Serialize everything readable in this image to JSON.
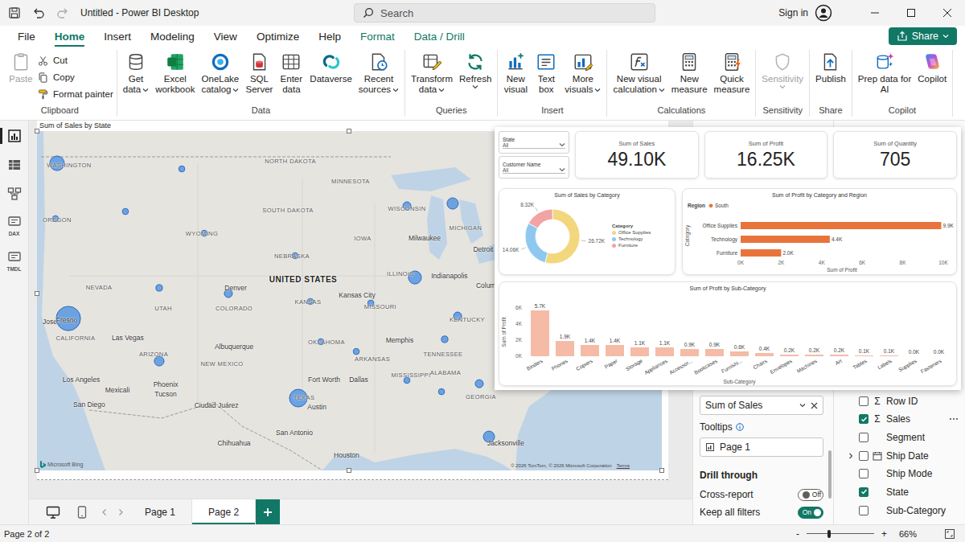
{
  "window": {
    "title": "Untitled - Power BI Desktop",
    "search_placeholder": "Search",
    "sign_in": "Sign in"
  },
  "menu_tabs": [
    {
      "label": "File",
      "selected": false,
      "kind": "plain"
    },
    {
      "label": "Home",
      "selected": true,
      "kind": "plain"
    },
    {
      "label": "Insert",
      "selected": false,
      "kind": "plain"
    },
    {
      "label": "Modeling",
      "selected": false,
      "kind": "plain"
    },
    {
      "label": "View",
      "selected": false,
      "kind": "plain"
    },
    {
      "label": "Optimize",
      "selected": false,
      "kind": "plain"
    },
    {
      "label": "Help",
      "selected": false,
      "kind": "plain"
    },
    {
      "label": "Format",
      "selected": false,
      "kind": "context"
    },
    {
      "label": "Data / Drill",
      "selected": false,
      "kind": "context"
    }
  ],
  "share_button": {
    "label": "Share",
    "dropdown": true
  },
  "ribbon_groups": [
    {
      "title": "Clipboard",
      "items": [
        {
          "lines": [
            "Paste"
          ],
          "kind": "large",
          "disabled": true,
          "dropdown": false
        },
        {
          "lines": [
            "Cut"
          ],
          "kind": "small",
          "disabled": false,
          "dropdown": false
        },
        {
          "lines": [
            "Copy"
          ],
          "kind": "small",
          "disabled": false,
          "dropdown": false
        },
        {
          "lines": [
            "Format painter"
          ],
          "kind": "small",
          "disabled": false,
          "dropdown": false
        }
      ]
    },
    {
      "title": "Data",
      "items": [
        {
          "lines": [
            "Get",
            "data"
          ],
          "kind": "large",
          "disabled": false,
          "dropdown": true
        },
        {
          "lines": [
            "Excel",
            "workbook"
          ],
          "kind": "large",
          "disabled": false,
          "dropdown": false
        },
        {
          "lines": [
            "OneLake",
            "catalog"
          ],
          "kind": "large",
          "disabled": false,
          "dropdown": true
        },
        {
          "lines": [
            "SQL",
            "Server"
          ],
          "kind": "large",
          "disabled": false,
          "dropdown": false
        },
        {
          "lines": [
            "Enter",
            "data"
          ],
          "kind": "large",
          "disabled": false,
          "dropdown": false
        },
        {
          "lines": [
            "Dataverse"
          ],
          "kind": "large",
          "disabled": false,
          "dropdown": false
        },
        {
          "lines": [
            "Recent",
            "sources"
          ],
          "kind": "large",
          "disabled": false,
          "dropdown": true
        }
      ]
    },
    {
      "title": "Queries",
      "items": [
        {
          "lines": [
            "Transform",
            "data"
          ],
          "kind": "large",
          "disabled": false,
          "dropdown": true
        },
        {
          "lines": [
            "Refresh"
          ],
          "kind": "large",
          "disabled": false,
          "dropdown": true
        }
      ]
    },
    {
      "title": "Insert",
      "items": [
        {
          "lines": [
            "New",
            "visual"
          ],
          "kind": "large",
          "disabled": false,
          "dropdown": false
        },
        {
          "lines": [
            "Text",
            "box"
          ],
          "kind": "large",
          "disabled": false,
          "dropdown": false
        },
        {
          "lines": [
            "More",
            "visuals"
          ],
          "kind": "large",
          "disabled": false,
          "dropdown": true
        }
      ]
    },
    {
      "title": "Calculations",
      "items": [
        {
          "lines": [
            "New visual",
            "calculation"
          ],
          "kind": "large",
          "disabled": false,
          "dropdown": true
        },
        {
          "lines": [
            "New",
            "measure"
          ],
          "kind": "large",
          "disabled": false,
          "dropdown": false
        },
        {
          "lines": [
            "Quick",
            "measure"
          ],
          "kind": "large",
          "disabled": false,
          "dropdown": false
        }
      ]
    },
    {
      "title": "Sensitivity",
      "items": [
        {
          "lines": [
            "Sensitivity"
          ],
          "kind": "large",
          "disabled": true,
          "dropdown": true
        }
      ]
    },
    {
      "title": "Share",
      "items": [
        {
          "lines": [
            "Publish"
          ],
          "kind": "large",
          "disabled": false,
          "dropdown": false
        }
      ]
    },
    {
      "title": "Copilot",
      "items": [
        {
          "lines": [
            "Prep data for",
            "AI"
          ],
          "kind": "large",
          "disabled": false,
          "dropdown": false
        },
        {
          "lines": [
            "Copilot"
          ],
          "kind": "large",
          "disabled": false,
          "dropdown": false
        }
      ]
    }
  ],
  "left_rail": [
    {
      "selected": true
    },
    {
      "selected": false
    },
    {
      "selected": false
    },
    {
      "selected": false,
      "caption": "DAX"
    },
    {
      "selected": false,
      "caption": "TMDL"
    }
  ],
  "map_visual": {
    "title": "Sum of Sales by State",
    "selected": true,
    "labels": [
      {
        "text": "WASHINGTON",
        "kind": "state",
        "lon": -119.72,
        "lat": 47.6
      },
      {
        "text": "OREGON",
        "kind": "state",
        "lon": -120.78,
        "lat": 44.19
      },
      {
        "text": "NORTH DAKOTA",
        "kind": "state",
        "lon": -100.34,
        "lat": 47.85
      },
      {
        "text": "MINNESOTA",
        "kind": "state",
        "lon": -95.06,
        "lat": 46.6
      },
      {
        "text": "SOUTH DAKOTA",
        "kind": "state",
        "lon": -100.55,
        "lat": 44.79
      },
      {
        "text": "WYOMING",
        "kind": "state",
        "lon": -108.09,
        "lat": 43.33
      },
      {
        "text": "WISCONSIN",
        "kind": "state",
        "lon": -90.12,
        "lat": 44.89
      },
      {
        "text": "MICHIGAN",
        "kind": "state",
        "lon": -84.98,
        "lat": 43.69
      },
      {
        "text": "Milwaukee",
        "kind": "city",
        "lon": -88.57,
        "lat": 43.03
      },
      {
        "text": "IOWA",
        "kind": "state",
        "lon": -94.0,
        "lat": 43.03
      },
      {
        "text": "NEBRASKA",
        "kind": "state",
        "lon": -100.2,
        "lat": 41.93
      },
      {
        "text": "Detroit",
        "kind": "city",
        "lon": -83.43,
        "lat": 42.33
      },
      {
        "text": "NEVADA",
        "kind": "state",
        "lon": -117.11,
        "lat": 39.97
      },
      {
        "text": "UNITED STATES",
        "kind": "country",
        "lon": -99.21,
        "lat": 40.47
      },
      {
        "text": "Denver",
        "kind": "city",
        "lon": -105.13,
        "lat": 39.92
      },
      {
        "text": "ILLINOIS",
        "kind": "state",
        "lon": -90.69,
        "lat": 40.82
      },
      {
        "text": "Indianapolis",
        "kind": "city",
        "lon": -86.39,
        "lat": 40.67
      },
      {
        "text": "Columbus",
        "kind": "city",
        "lon": -82.72,
        "lat": 40.07
      },
      {
        "text": "UTAH",
        "kind": "state",
        "lon": -111.47,
        "lat": 38.67
      },
      {
        "text": "COLORADO",
        "kind": "state",
        "lon": -105.27,
        "lat": 38.67
      },
      {
        "text": "KANSAS",
        "kind": "state",
        "lon": -98.79,
        "lat": 39.07
      },
      {
        "text": "Kansas City",
        "kind": "city",
        "lon": -94.49,
        "lat": 39.47
      },
      {
        "text": "MISSOURI",
        "kind": "state",
        "lon": -92.45,
        "lat": 38.77
      },
      {
        "text": "KENTUCKY",
        "kind": "state",
        "lon": -84.84,
        "lat": 37.96
      },
      {
        "text": "Jose",
        "kind": "city",
        "lon": -121.41,
        "lat": 37.8
      },
      {
        "text": "Fresno",
        "kind": "city",
        "lon": -119.93,
        "lat": 37.91
      },
      {
        "text": "CALIFORNIA",
        "kind": "state",
        "lon": -119.16,
        "lat": 36.81
      },
      {
        "text": "Las Vegas",
        "kind": "city",
        "lon": -114.58,
        "lat": 36.81
      },
      {
        "text": "TENNESSEE",
        "kind": "state",
        "lon": -86.95,
        "lat": 35.8
      },
      {
        "text": "Los Angeles",
        "kind": "city",
        "lon": -118.66,
        "lat": 34.2
      },
      {
        "text": "ARIZONA",
        "kind": "state",
        "lon": -112.32,
        "lat": 35.8
      },
      {
        "text": "Albuquerque",
        "kind": "city",
        "lon": -105.27,
        "lat": 36.26
      },
      {
        "text": "OKLAHOMA",
        "kind": "state",
        "lon": -97.17,
        "lat": 36.56
      },
      {
        "text": "NEW MEXICO",
        "kind": "state",
        "lon": -106.33,
        "lat": 35.2
      },
      {
        "text": "Memphis",
        "kind": "city",
        "lon": -90.76,
        "lat": 36.66
      },
      {
        "text": "ARKANSAS",
        "kind": "state",
        "lon": -93.15,
        "lat": 35.5
      },
      {
        "text": "San Diego",
        "kind": "city",
        "lon": -117.96,
        "lat": 32.64
      },
      {
        "text": "Phoenix",
        "kind": "city",
        "lon": -111.26,
        "lat": 33.9
      },
      {
        "text": "Mexicali",
        "kind": "city",
        "lon": -115.49,
        "lat": 33.55
      },
      {
        "text": "Tucson",
        "kind": "city",
        "lon": -111.26,
        "lat": 33.29
      },
      {
        "text": "Fort Worth",
        "kind": "city",
        "lon": -97.38,
        "lat": 34.2
      },
      {
        "text": "Dallas",
        "kind": "city",
        "lon": -94.35,
        "lat": 34.2
      },
      {
        "text": "MISSISSIPPI",
        "kind": "state",
        "lon": -89.77,
        "lat": 34.5
      },
      {
        "text": "ALABAMA",
        "kind": "state",
        "lon": -86.74,
        "lat": 34.65
      },
      {
        "text": "GEORGIA",
        "kind": "state",
        "lon": -83.64,
        "lat": 33.14
      },
      {
        "text": "Ciudad Juárez",
        "kind": "city",
        "lon": -106.82,
        "lat": 32.59
      },
      {
        "text": "Chihuahua",
        "kind": "city",
        "lon": -105.27,
        "lat": 30.23
      },
      {
        "text": "TEXAS",
        "kind": "state",
        "lon": -99.14,
        "lat": 33.09
      },
      {
        "text": "Austin",
        "kind": "city",
        "lon": -98.01,
        "lat": 32.49
      },
      {
        "text": "San Antonio",
        "kind": "city",
        "lon": -99.99,
        "lat": 30.88
      },
      {
        "text": "Houston",
        "kind": "city",
        "lon": -95.41,
        "lat": 29.48
      },
      {
        "text": "Jacksonville",
        "kind": "city",
        "lon": -81.45,
        "lat": 30.23
      }
    ],
    "bubbles": [
      {
        "lon": -120.78,
        "lat": 47.7,
        "sales": 3.0
      },
      {
        "lon": -109.85,
        "lat": 47.35,
        "sales": 0.05
      },
      {
        "lon": -120.92,
        "lat": 44.24,
        "sales": 0.05
      },
      {
        "lon": -114.79,
        "lat": 44.69,
        "sales": 0.05
      },
      {
        "lon": -107.88,
        "lat": 43.33,
        "sales": 0.05
      },
      {
        "lon": -111.83,
        "lat": 39.92,
        "sales": 0.1
      },
      {
        "lon": -119.79,
        "lat": 38.01,
        "sales": 12.0
      },
      {
        "lon": -105.77,
        "lat": 39.57,
        "sales": 0.33
      },
      {
        "lon": -111.83,
        "lat": 35.35,
        "sales": 0.75
      },
      {
        "lon": -99.92,
        "lat": 41.93,
        "sales": 0.05
      },
      {
        "lon": -98.58,
        "lat": 39.07,
        "sales": 0.05
      },
      {
        "lon": -97.66,
        "lat": 36.56,
        "sales": 0.05
      },
      {
        "lon": -93.29,
        "lat": 38.97,
        "sales": 0.05
      },
      {
        "lon": -94.56,
        "lat": 35.95,
        "sales": 0.05
      },
      {
        "lon": -90.12,
        "lat": 45.04,
        "sales": 0.33
      },
      {
        "lon": -86.11,
        "lat": 45.19,
        "sales": 1.3
      },
      {
        "lon": -89.42,
        "lat": 40.57,
        "sales": 2.1
      },
      {
        "lon": -85.68,
        "lat": 38.16,
        "sales": 0.33
      },
      {
        "lon": -86.81,
        "lat": 36.71,
        "sales": 0.1
      },
      {
        "lon": -90.12,
        "lat": 34.15,
        "sales": 0.05
      },
      {
        "lon": -87.09,
        "lat": 33.44,
        "sales": 0.05
      },
      {
        "lon": -83.78,
        "lat": 33.94,
        "sales": 0.33
      },
      {
        "lon": -99.64,
        "lat": 33.04,
        "sales": 5.2
      },
      {
        "lon": -82.93,
        "lat": 30.63,
        "sales": 1.3
      }
    ],
    "attribution": {
      "brand": "Microsoft Bing",
      "copyright": "© 2026 TomTom, © 2026 Microsoft Corporation",
      "terms": "Terms"
    }
  },
  "tooltip_page": {
    "slicers": [
      {
        "label": "State",
        "value": "All"
      },
      {
        "label": "Customer Name",
        "value": "All"
      }
    ],
    "cards": [
      {
        "label": "Sum of Sales",
        "value": "49.10K"
      },
      {
        "label": "Sum of Profit",
        "value": "16.25K"
      },
      {
        "label": "Sum of Quantity",
        "value": "705"
      }
    ],
    "donut": {
      "title": "Sum of Sales by Category",
      "legend_title": "Category",
      "slices": [
        {
          "label": "Office Supplies",
          "value": 26.72,
          "value_label": "26.72K",
          "color": "#f2d77e"
        },
        {
          "label": "Technology",
          "value": 14.06,
          "value_label": "14.06K",
          "color": "#8fc8ef"
        },
        {
          "label": "Furniture",
          "value": 8.32,
          "value_label": "8.32K",
          "color": "#f2a3a3"
        }
      ]
    },
    "bar_chart": {
      "title": "Sum of Profit by Category and Region",
      "legend_title": "Region",
      "series": {
        "name": "South",
        "color": "#e8743b"
      },
      "categories": [
        {
          "label": "Office Supplies",
          "value": 9.9,
          "value_label": "9.9K"
        },
        {
          "label": "Technology",
          "value": 4.4,
          "value_label": "4.4K"
        },
        {
          "label": "Furniture",
          "value": 2.0,
          "value_label": "2.0K"
        }
      ],
      "x_ticks": [
        "0K",
        "2K",
        "4K",
        "6K",
        "8K",
        "10K"
      ],
      "x_title": "Sum of Profit",
      "y_title": "Category"
    },
    "column_chart": {
      "title": "Sum of Profit by Sub-Category",
      "color": "#f5bba6",
      "y_ticks": [
        "0K",
        "2K",
        "4K",
        "6K"
      ],
      "y_title": "Sum of Profit",
      "x_title": "Sub-Category",
      "bars": [
        {
          "label": "Binders",
          "value": 5.7,
          "value_label": "5.7K"
        },
        {
          "label": "Phones",
          "value": 1.9,
          "value_label": "1.9K"
        },
        {
          "label": "Copiers",
          "value": 1.4,
          "value_label": "1.4K"
        },
        {
          "label": "Paper",
          "value": 1.4,
          "value_label": "1.4K"
        },
        {
          "label": "Storage",
          "value": 1.1,
          "value_label": "1.1K"
        },
        {
          "label": "Appliances",
          "value": 1.1,
          "value_label": "1.1K"
        },
        {
          "label": "Accessor...",
          "value": 0.9,
          "value_label": "0.9K"
        },
        {
          "label": "Bookcases",
          "value": 0.9,
          "value_label": "0.9K"
        },
        {
          "label": "Furnishi...",
          "value": 0.6,
          "value_label": "0.6K"
        },
        {
          "label": "Chairs",
          "value": 0.4,
          "value_label": "0.4K"
        },
        {
          "label": "Envelopes",
          "value": 0.2,
          "value_label": "0.2K"
        },
        {
          "label": "Machines",
          "value": 0.2,
          "value_label": "0.2K"
        },
        {
          "label": "Art",
          "value": 0.2,
          "value_label": "0.2K"
        },
        {
          "label": "Tables",
          "value": 0.1,
          "value_label": "0.1K"
        },
        {
          "label": "Labels",
          "value": 0.1,
          "value_label": "0.1K"
        },
        {
          "label": "Supplies",
          "value": 0.0,
          "value_label": "0.0K"
        },
        {
          "label": "Fasteners",
          "value": 0.0,
          "value_label": "0.0K"
        }
      ]
    }
  },
  "visualizations_pane": {
    "value_well": "Sum of Sales",
    "tooltips_label": "Tooltips",
    "tooltips_well": "Page 1",
    "drill_title": "Drill through",
    "toggles": [
      {
        "label": "Cross-report",
        "on": false,
        "state_label": "Off"
      },
      {
        "label": "Keep all filters",
        "on": true,
        "state_label": "On"
      }
    ]
  },
  "data_pane": {
    "fields": [
      {
        "label": "Row ID",
        "checked": false,
        "kind": "measure",
        "prefix": "Σ",
        "show_more": false
      },
      {
        "label": "Sales",
        "checked": true,
        "kind": "measure",
        "prefix": "Σ",
        "show_more": true
      },
      {
        "label": "Segment",
        "checked": false,
        "kind": "text",
        "show_more": false
      },
      {
        "label": "Ship Date",
        "checked": false,
        "kind": "date",
        "expanded": false,
        "show_more": false
      },
      {
        "label": "Ship Mode",
        "checked": false,
        "kind": "text",
        "show_more": false
      },
      {
        "label": "State",
        "checked": true,
        "kind": "text",
        "show_more": false
      },
      {
        "label": "Sub-Category",
        "checked": false,
        "kind": "text",
        "show_more": false
      }
    ]
  },
  "page_tabs": {
    "views": [
      {
        "selected": true
      },
      {
        "selected": false
      }
    ],
    "pages": [
      {
        "label": "Page 1",
        "selected": false
      },
      {
        "label": "Page 2",
        "selected": true
      }
    ]
  },
  "status_bar": {
    "page_info": "Page 2 of 2",
    "zoom": {
      "minus": "-",
      "plus": "+",
      "label": "66%",
      "level": 0.33
    }
  }
}
